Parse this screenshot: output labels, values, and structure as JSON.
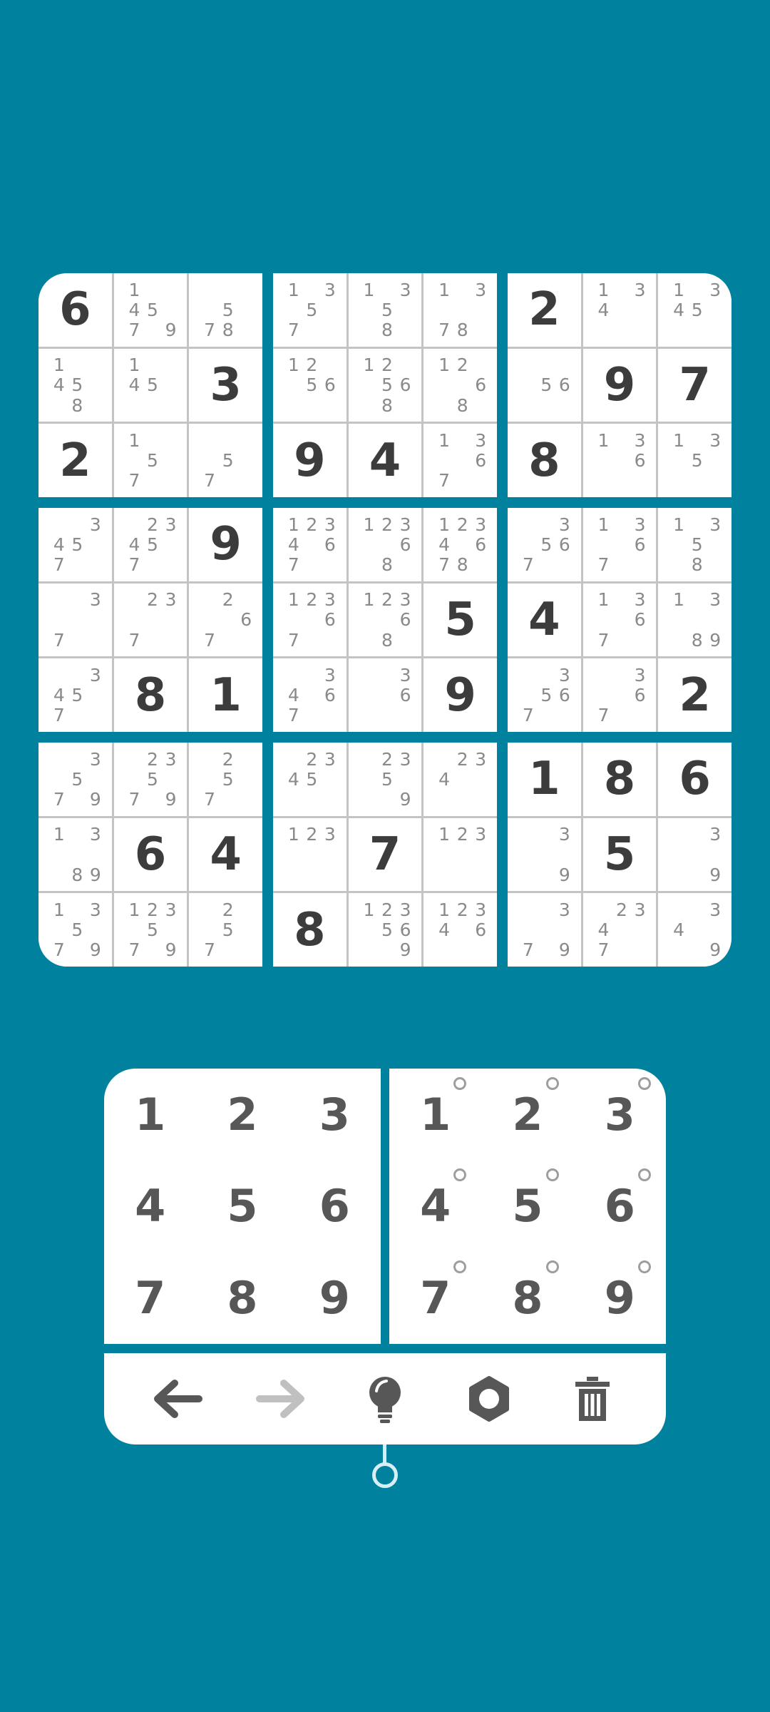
{
  "colors": {
    "background": "#00829f",
    "cell": "#ffffff",
    "given_digit": "#3c3c3c",
    "note_digit": "#8a8a8a",
    "grid_line": "#c4c4c4",
    "toolbar_icon": "#575757",
    "toolbar_icon_disabled": "#c0c0c0"
  },
  "board": {
    "cells": [
      [
        {
          "v": "6"
        },
        {
          "n": "1457 9"
        },
        {
          "n": "578"
        },
        {
          "n": "1357"
        },
        {
          "n": "1358"
        },
        {
          "n": "1378"
        },
        {
          "v": "2"
        },
        {
          "n": "134"
        },
        {
          "n": "1345"
        }
      ],
      [
        {
          "n": "1458"
        },
        {
          "n": "145"
        },
        {
          "v": "3"
        },
        {
          "n": "1256"
        },
        {
          "n": "12568"
        },
        {
          "n": "1268"
        },
        {
          "n": "56"
        },
        {
          "v": "9"
        },
        {
          "v": "7"
        }
      ],
      [
        {
          "v": "2"
        },
        {
          "n": "157"
        },
        {
          "n": "57"
        },
        {
          "v": "9"
        },
        {
          "v": "4"
        },
        {
          "n": "1367"
        },
        {
          "v": "8"
        },
        {
          "n": "136"
        },
        {
          "n": "135"
        }
      ],
      [
        {
          "n": "3457"
        },
        {
          "n": "23457"
        },
        {
          "v": "9"
        },
        {
          "n": "123467"
        },
        {
          "n": "12368"
        },
        {
          "n": "12346 78"
        },
        {
          "n": "3567"
        },
        {
          "n": "1367"
        },
        {
          "n": "1358"
        }
      ],
      [
        {
          "n": "37"
        },
        {
          "n": "237"
        },
        {
          "n": "267"
        },
        {
          "n": "12367"
        },
        {
          "n": "12368"
        },
        {
          "v": "5"
        },
        {
          "v": "4"
        },
        {
          "n": "1367"
        },
        {
          "n": "1389"
        }
      ],
      [
        {
          "n": "3457"
        },
        {
          "v": "8"
        },
        {
          "v": "1"
        },
        {
          "n": "3467"
        },
        {
          "n": "36"
        },
        {
          "v": "9"
        },
        {
          "n": "3567"
        },
        {
          "n": "367"
        },
        {
          "v": "2"
        }
      ],
      [
        {
          "n": "3579"
        },
        {
          "n": "23579"
        },
        {
          "n": "257"
        },
        {
          "n": "2345"
        },
        {
          "n": "2359"
        },
        {
          "n": "234"
        },
        {
          "v": "1"
        },
        {
          "v": "8"
        },
        {
          "v": "6"
        }
      ],
      [
        {
          "n": "1389"
        },
        {
          "v": "6"
        },
        {
          "v": "4"
        },
        {
          "n": "123"
        },
        {
          "v": "7"
        },
        {
          "n": "123"
        },
        {
          "n": "39"
        },
        {
          "v": "5"
        },
        {
          "n": "39"
        }
      ],
      [
        {
          "n": "13579"
        },
        {
          "n": "123579"
        },
        {
          "n": "257"
        },
        {
          "v": "8"
        },
        {
          "n": "123569"
        },
        {
          "n": "12346"
        },
        {
          "n": "379"
        },
        {
          "n": "2347"
        },
        {
          "n": "349"
        }
      ]
    ]
  },
  "numpad": {
    "digits": [
      "1",
      "2",
      "3",
      "4",
      "5",
      "6",
      "7",
      "8",
      "9"
    ]
  },
  "notepad": {
    "digits": [
      "1",
      "2",
      "3",
      "4",
      "5",
      "6",
      "7",
      "8",
      "9"
    ]
  },
  "toolbar": {
    "tools": [
      {
        "name": "undo-button",
        "icon": "arrow-left-icon",
        "enabled": true
      },
      {
        "name": "redo-button",
        "icon": "arrow-right-icon",
        "enabled": false
      },
      {
        "name": "hint-button",
        "icon": "lightbulb-icon",
        "enabled": true
      },
      {
        "name": "settings-button",
        "icon": "gear-icon",
        "enabled": true
      },
      {
        "name": "delete-button",
        "icon": "trash-icon",
        "enabled": true
      }
    ]
  }
}
